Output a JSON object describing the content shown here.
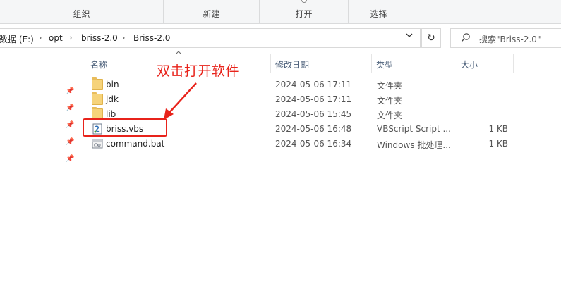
{
  "ribbon": {
    "groups": [
      {
        "label": "组织"
      },
      {
        "label": "新建"
      },
      {
        "label": "打开"
      },
      {
        "label": "选择"
      }
    ]
  },
  "address": {
    "crumbs": [
      "数据 (E:)",
      "opt",
      "briss-2.0",
      "Briss-2.0"
    ],
    "separator": "›"
  },
  "search": {
    "placeholder": "搜索\"Briss-2.0\""
  },
  "columns": {
    "name": "名称",
    "modified": "修改日期",
    "type": "类型",
    "size": "大小"
  },
  "files": [
    {
      "name": "bin",
      "modified": "2024-05-06 17:11",
      "type": "文件夹",
      "size": "",
      "icon": "folder-icon"
    },
    {
      "name": "jdk",
      "modified": "2024-05-06 17:11",
      "type": "文件夹",
      "size": "",
      "icon": "folder-icon"
    },
    {
      "name": "lib",
      "modified": "2024-05-06 15:45",
      "type": "文件夹",
      "size": "",
      "icon": "folder-icon"
    },
    {
      "name": "briss.vbs",
      "modified": "2024-05-06 16:48",
      "type": "VBScript Script ...",
      "size": "1 KB",
      "icon": "vbscript-file-icon"
    },
    {
      "name": "command.bat",
      "modified": "2024-05-06 16:34",
      "type": "Windows 批处理...",
      "size": "1 KB",
      "icon": "batch-file-icon"
    }
  ],
  "annotation": {
    "text": "双击打开软件",
    "color": "#e8231b"
  }
}
